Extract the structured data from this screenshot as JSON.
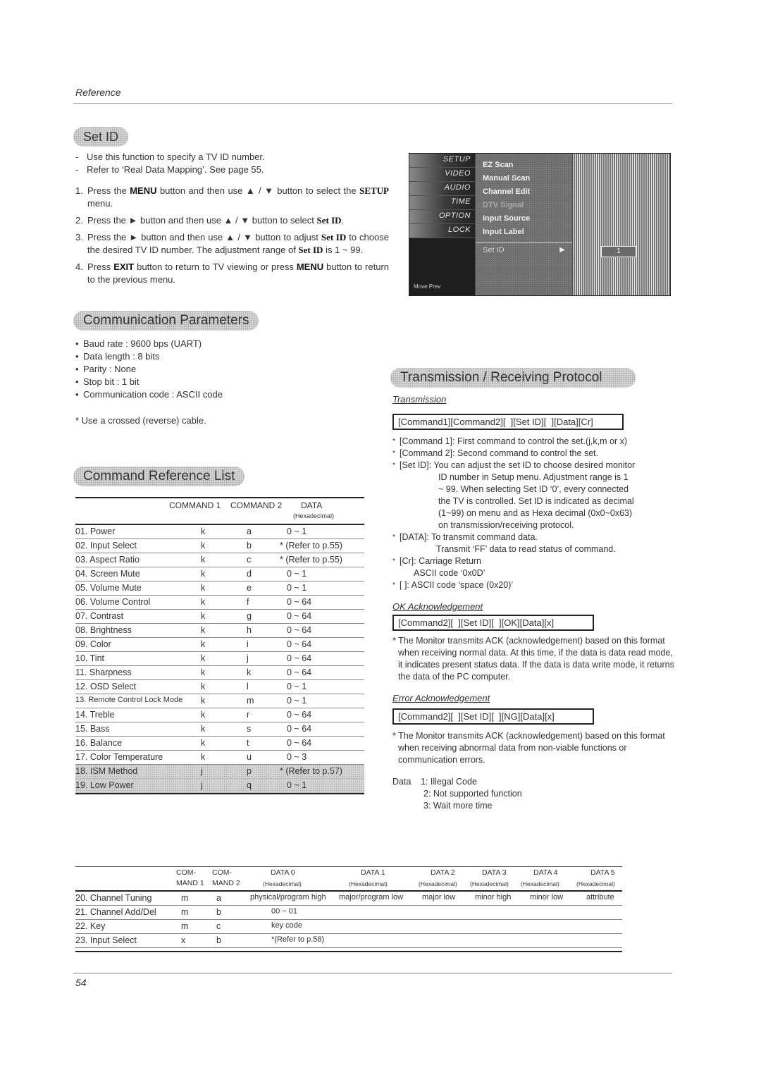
{
  "header": {
    "section": "Reference"
  },
  "set_id": {
    "title": "Set ID",
    "intro": [
      "Use this function to specify a TV ID number.",
      "Refer to ‘Real Data Mapping’. See page 55."
    ],
    "steps": [
      {
        "num": "1.",
        "pre": "Press the ",
        "b1": "MENU",
        "mid": " button and then use ▲ / ▼  button to select the ",
        "b2": "SETUP",
        "post": " menu."
      },
      {
        "num": "2.",
        "pre": "Press the ► button and then use ▲ / ▼  button to select ",
        "b1": "Set ID",
        "post": "."
      },
      {
        "num": "3.",
        "pre": "Press the ► button and then use ▲ / ▼ button to adjust ",
        "b1": "Set ID",
        "mid": " to choose the desired TV ID number. The adjustment range of ",
        "b2": "Set ID",
        "post": " is 1 ~ 99."
      },
      {
        "num": "4.",
        "pre": "Press ",
        "b1": "EXIT",
        "mid": " button to return to TV viewing or press ",
        "b2": "MENU",
        "post": " button to return to the previous menu."
      }
    ]
  },
  "tv_menu": {
    "tabs": [
      "SETUP",
      "VIDEO",
      "AUDIO",
      "TIME",
      "OPTION",
      "LOCK"
    ],
    "items": [
      "EZ Scan",
      "Manual Scan",
      "Channel Edit",
      "DTV Signal",
      "Input Source",
      "Input Label",
      "Set ID"
    ],
    "value": "1",
    "footer": "Move   Prev"
  },
  "comm_params": {
    "title": "Communication Parameters",
    "items": [
      "Baud rate : 9600 bps (UART)",
      "Data length : 8 bits",
      "Parity : None",
      "Stop bit : 1 bit",
      "Communication code : ASCII code"
    ],
    "note": "* Use a crossed (reverse) cable."
  },
  "cmd_list": {
    "title": "Command Reference List",
    "headers": {
      "c1": "COMMAND 1",
      "c2": "COMMAND 2",
      "data": "DATA",
      "data_sub": "(Hexadecimal)"
    },
    "rows": [
      {
        "name": "01. Power",
        "c1": "k",
        "c2": "a",
        "data": "0 ~ 1"
      },
      {
        "name": "02. Input Select",
        "c1": "k",
        "c2": "b",
        "data": "* (Refer to p.55)"
      },
      {
        "name": "03. Aspect Ratio",
        "c1": "k",
        "c2": "c",
        "data": "* (Refer to p.55)"
      },
      {
        "name": "04. Screen Mute",
        "c1": "k",
        "c2": "d",
        "data": "0 ~ 1"
      },
      {
        "name": "05. Volume Mute",
        "c1": "k",
        "c2": "e",
        "data": "0 ~ 1"
      },
      {
        "name": "06. Volume Control",
        "c1": "k",
        "c2": "f",
        "data": "0 ~ 64"
      },
      {
        "name": "07. Contrast",
        "c1": "k",
        "c2": "g",
        "data": "0 ~ 64"
      },
      {
        "name": "08. Brightness",
        "c1": "k",
        "c2": "h",
        "data": "0 ~ 64"
      },
      {
        "name": "09. Color",
        "c1": "k",
        "c2": "i",
        "data": "0 ~ 64"
      },
      {
        "name": "10. Tint",
        "c1": "k",
        "c2": "j",
        "data": "0 ~ 64"
      },
      {
        "name": "11. Sharpness",
        "c1": "k",
        "c2": "k",
        "data": "0 ~ 64"
      },
      {
        "name": "12. OSD Select",
        "c1": "k",
        "c2": "l",
        "data": "0 ~ 1"
      },
      {
        "name": "13. Remote Control Lock Mode",
        "c1": "k",
        "c2": "m",
        "data": "0 ~ 1"
      },
      {
        "name": "14. Treble",
        "c1": "k",
        "c2": "r",
        "data": "0 ~ 64"
      },
      {
        "name": "15. Bass",
        "c1": "k",
        "c2": "s",
        "data": "0 ~ 64"
      },
      {
        "name": "16. Balance",
        "c1": "k",
        "c2": "t",
        "data": "0 ~ 64"
      },
      {
        "name": "17. Color Temperature",
        "c1": "k",
        "c2": "u",
        "data": "0 ~ 3"
      },
      {
        "name": "18. ISM Method",
        "c1": "j",
        "c2": "p",
        "data": "* (Refer to p.57)"
      },
      {
        "name": "19. Low Power",
        "c1": "j",
        "c2": "q",
        "data": "0 ~ 1"
      }
    ]
  },
  "protocol": {
    "title": "Transmission / Receiving Protocol",
    "transmission_label": "Transmission",
    "transmission_format": "[Command1][Command2][  ][Set ID][  ][Data][Cr]",
    "notes": [
      "[Command 1]: First command to control the set.(j,k,m or x)",
      "[Command 2]: Second command to control the set.",
      "[Set ID]: You can adjust the set ID to choose desired monitor",
      "ID number in Setup menu. Adjustment range is 1",
      "~ 99. When selecting Set ID ‘0’, every connected",
      "the TV is controlled. Set ID is indicated as decimal",
      "(1~99) on menu and as Hexa decimal (0x0~0x63)",
      "on transmission/receiving protocol.",
      "[DATA]: To transmit command data.",
      "Transmit ‘FF’ data to read status of command.",
      "[Cr]: Carriage Return",
      "ASCII code ‘0x0D’",
      "[   ]: ASCII code ‘space (0x20)’"
    ],
    "ok_label": "OK Acknowledgement",
    "ok_format": "[Command2][  ][Set ID][  ][OK][Data][x]",
    "ok_note": "* The Monitor transmits ACK (acknowledgement) based on this format when receiving normal data. At this time, if the data is data read mode, it indicates present status data. If the data is data write mode, it returns the data of the PC computer.",
    "err_label": "Error Acknowledgement",
    "err_format": "[Command2][  ][Set ID][  ][NG][Data][x]",
    "err_note": "* The Monitor transmits ACK (acknowledgement) based on this format when receiving abnormal data from non-viable functions or communication errors.",
    "data_label": "Data",
    "data_codes": [
      "1: Illegal Code",
      "2: Not supported function",
      "3: Wait more time"
    ]
  },
  "ext_table": {
    "headers": [
      {
        "top": "COM-",
        "bottom": "MAND 1"
      },
      {
        "top": "COM-",
        "bottom": "MAND 2"
      },
      {
        "top": "DATA 0",
        "bottom": "(Hexadecimal)"
      },
      {
        "top": "DATA 1",
        "bottom": "(Hexadecimal)"
      },
      {
        "top": "DATA 2",
        "bottom": "(Hexadecimal)"
      },
      {
        "top": "DATA 3",
        "bottom": "(Hexadecimal)"
      },
      {
        "top": "DATA 4",
        "bottom": "(Hexadecimal)"
      },
      {
        "top": "DATA 5",
        "bottom": "(Hexadecimal)"
      }
    ],
    "rows": [
      {
        "name": "20. Channel Tuning",
        "c1": "m",
        "c2": "a",
        "d0": "physical/program high",
        "d1": "major/program low",
        "d2": "major low",
        "d3": "minor high",
        "d4": "minor low",
        "d5": "attribute"
      },
      {
        "name": "21. Channel Add/Del",
        "c1": "m",
        "c2": "b",
        "d0": "00 ~ 01"
      },
      {
        "name": "22. Key",
        "c1": "m",
        "c2": "c",
        "d0": "key code"
      },
      {
        "name": "23. Input Select",
        "c1": "x",
        "c2": "b",
        "d0": "*(Refer to p.58)"
      }
    ]
  },
  "footer": {
    "page": "54"
  }
}
